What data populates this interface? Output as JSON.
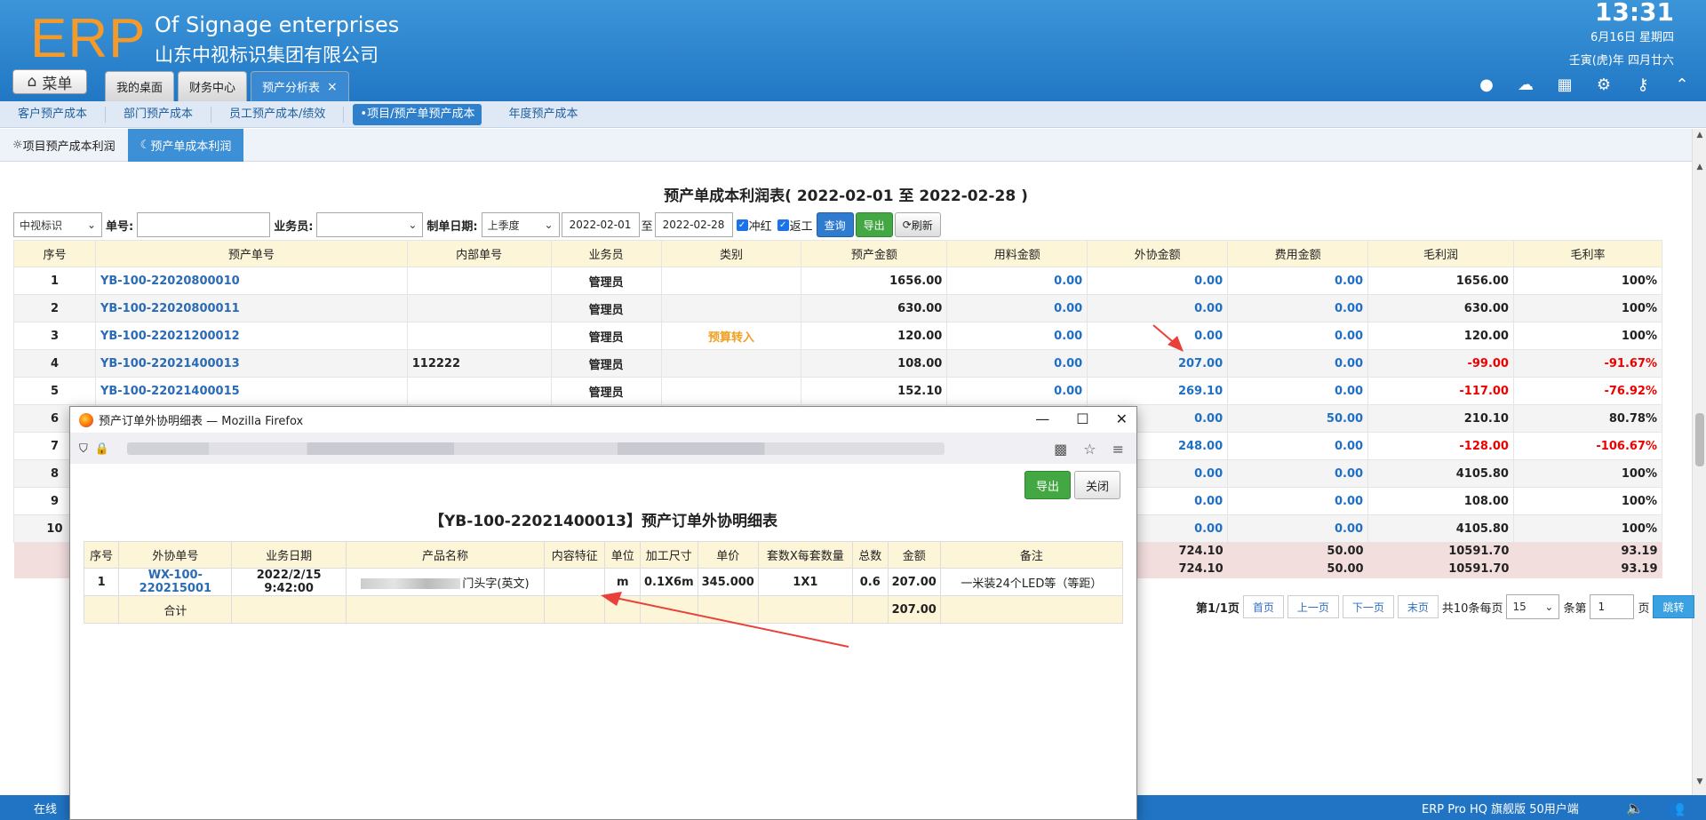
{
  "header": {
    "logo": "ERP",
    "company_en": "Of Signage enterprises",
    "company_cn": "山东中视标识集团有限公司",
    "time": "13:31",
    "date": "6月16日 星期四",
    "lunar": "壬寅(虎)年 四月廿六",
    "menu_label": "菜单"
  },
  "tabs": [
    {
      "label": "我的桌面"
    },
    {
      "label": "财务中心"
    },
    {
      "label": "预产分析表",
      "close": "×"
    }
  ],
  "subnav": [
    "客户预产成本",
    "部门预产成本",
    "员工预产成本/绩效",
    "•项目/预产单预产成本",
    "年度预产成本"
  ],
  "subtabs": [
    "项目预产成本利润",
    "预产单成本利润"
  ],
  "report": {
    "title": "预产单成本利润表( 2022-02-01 至 2022-02-28 )",
    "filter": {
      "company": "中视标识",
      "order_label": "单号:",
      "order_value": "",
      "staff_label": "业务员:",
      "staff_value": "",
      "date_label": "制单日期:",
      "period": "上季度",
      "date_from": "2022-02-01",
      "to": "至",
      "date_to": "2022-02-28",
      "cb1": "冲红",
      "cb2": "返工",
      "query": "查询",
      "export": "导出",
      "refresh": "刷新"
    },
    "columns": [
      "序号",
      "预产单号",
      "内部单号",
      "业务员",
      "类别",
      "预产金额",
      "用料金额",
      "外协金额",
      "费用金额",
      "毛利润",
      "毛利率"
    ],
    "rows": [
      [
        "1",
        "YB-100-22020800010",
        "",
        "管理员",
        "",
        "1656.00",
        "0.00",
        "0.00",
        "0.00",
        "1656.00",
        "100%"
      ],
      [
        "2",
        "YB-100-22020800011",
        "",
        "管理员",
        "",
        "630.00",
        "0.00",
        "0.00",
        "0.00",
        "630.00",
        "100%"
      ],
      [
        "3",
        "YB-100-22021200012",
        "",
        "管理员",
        "预算转入",
        "120.00",
        "0.00",
        "0.00",
        "0.00",
        "120.00",
        "100%"
      ],
      [
        "4",
        "YB-100-22021400013",
        "112222",
        "管理员",
        "",
        "108.00",
        "0.00",
        "207.00",
        "0.00",
        "-99.00",
        "-91.67%"
      ],
      [
        "5",
        "YB-100-22021400015",
        "",
        "管理员",
        "",
        "152.10",
        "0.00",
        "269.10",
        "0.00",
        "-117.00",
        "-76.92%"
      ],
      [
        "6",
        "",
        "",
        "",
        "",
        "",
        "",
        "0.00",
        "50.00",
        "210.10",
        "80.78%"
      ],
      [
        "7",
        "",
        "",
        "",
        "",
        "",
        "",
        "248.00",
        "0.00",
        "-128.00",
        "-106.67%"
      ],
      [
        "8",
        "",
        "",
        "",
        "",
        "",
        "",
        "0.00",
        "0.00",
        "4105.80",
        "100%"
      ],
      [
        "9",
        "",
        "",
        "",
        "",
        "",
        "",
        "0.00",
        "0.00",
        "108.00",
        "100%"
      ],
      [
        "10",
        "",
        "",
        "",
        "",
        "",
        "",
        "0.00",
        "0.00",
        "4105.80",
        "100%"
      ]
    ],
    "totals": [
      [
        "724.10",
        "50.00",
        "10591.70",
        "93.19"
      ],
      [
        "724.10",
        "50.00",
        "10591.70",
        "93.19"
      ]
    ],
    "pager": {
      "info": "第1/1页",
      "first": "首页",
      "prev": "上一页",
      "next": "下一页",
      "last": "末页",
      "count": "共10条每页",
      "per": "15",
      "goto_label": "条第",
      "page": "1",
      "page_suffix": "页",
      "jump": "跳转"
    }
  },
  "popup": {
    "window_title": "预产订单外协明细表 — Mozilla Firefox",
    "export": "导出",
    "close": "关闭",
    "title": "【YB-100-22021400013】预产订单外协明细表",
    "columns": [
      "序号",
      "外协单号",
      "业务日期",
      "产品名称",
      "内容特征",
      "单位",
      "加工尺寸",
      "单价",
      "套数X每套数量",
      "总数",
      "金额",
      "备注"
    ],
    "row": {
      "no": "1",
      "outsource_no": "WX-100-220215001",
      "date": "2022/2/15 9:42:00",
      "product": "门头字(英文)",
      "feature": "",
      "unit": "m",
      "size": "0.1X6m",
      "price": "345.000",
      "qty": "1X1",
      "total": "0.6",
      "amount": "207.00",
      "remark": "一米装24个LED等（等距）"
    },
    "sum_label": "合计",
    "sum_amount": "207.00"
  },
  "status": {
    "online": "在线",
    "product": "ERP Pro HQ 旗舰版 50用户端"
  },
  "colors": {
    "header": "#2a84cf",
    "accent": "#f39a2b",
    "link": "#2a6bb5",
    "negative": "#e00000",
    "arrow": "#e8413a"
  }
}
